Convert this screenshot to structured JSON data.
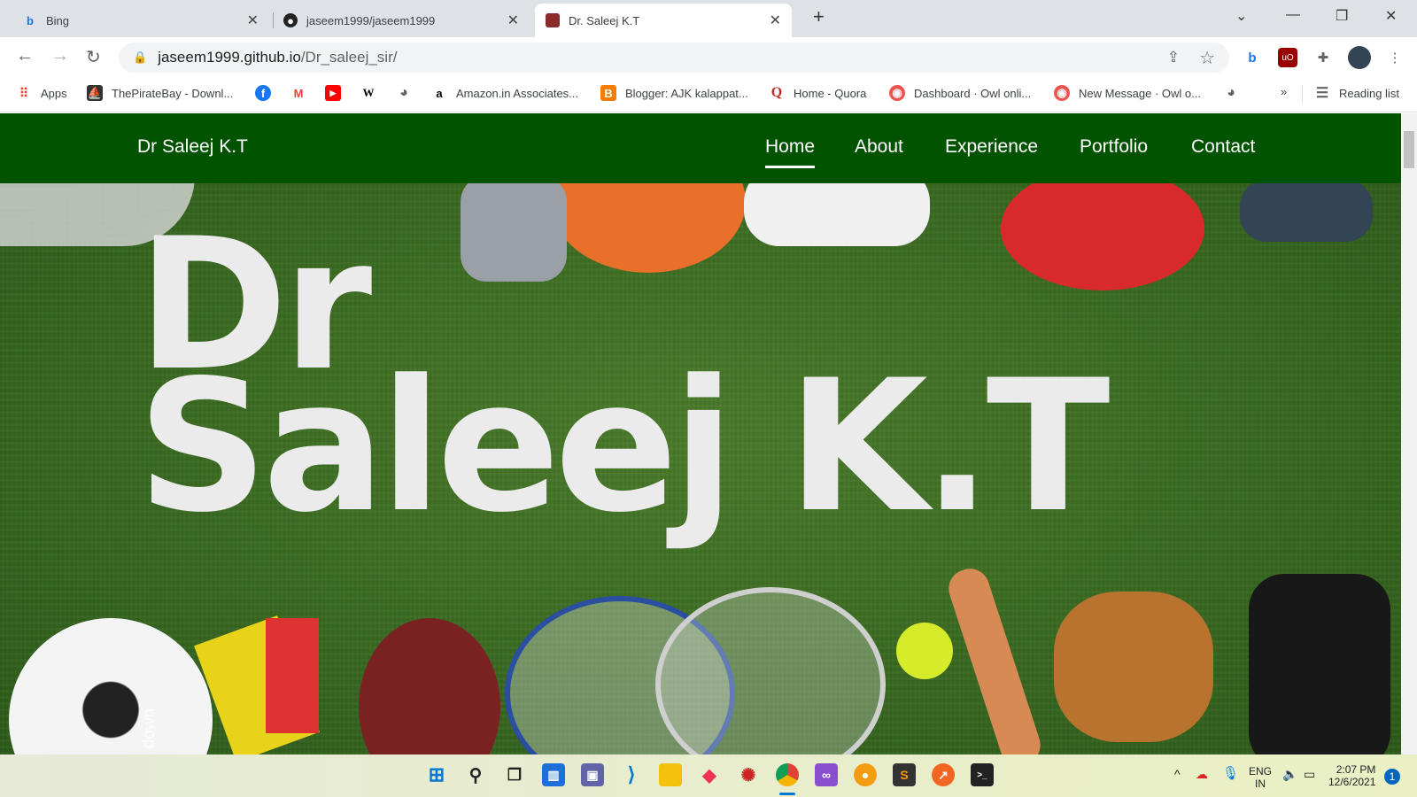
{
  "tabs": [
    {
      "title": "Bing",
      "icon": "bing-icon"
    },
    {
      "title": "jaseem1999/jaseem1999",
      "icon": "github-icon"
    },
    {
      "title": "Dr. Saleej K.T",
      "icon": "profile-icon",
      "active": true
    }
  ],
  "url": {
    "host": "jaseem1999.github.io",
    "path": "/Dr_saleej_sir/"
  },
  "bookmarks": [
    {
      "label": "Apps"
    },
    {
      "label": "ThePirateBay - Downl..."
    },
    {
      "label": "",
      "icon": "facebook-icon"
    },
    {
      "label": "",
      "icon": "gmail-icon"
    },
    {
      "label": "",
      "icon": "youtube-icon"
    },
    {
      "label": "",
      "icon": "wikipedia-icon"
    },
    {
      "label": "",
      "icon": "globe-icon"
    },
    {
      "label": "Amazon.in Associates..."
    },
    {
      "label": "Blogger: AJK kalappat..."
    },
    {
      "label": "Home - Quora"
    },
    {
      "label": "Dashboard · Owl onli..."
    },
    {
      "label": "New Message · Owl o..."
    },
    {
      "label": "",
      "icon": "globe-icon"
    }
  ],
  "reading_list": "Reading list",
  "overflow": "»",
  "site": {
    "brand": "Dr Saleej K.T",
    "nav": [
      "Home",
      "About",
      "Experience",
      "Portfolio",
      "Contact"
    ],
    "active_nav": "Home",
    "hero_line1": "Dr",
    "hero_line2": "Saleej K.T",
    "scroll": "↓ Scroll down"
  },
  "taskbar": {
    "lang1": "ENG",
    "lang2": "IN",
    "time": "2:07 PM",
    "date": "12/6/2021",
    "notifications": "1"
  },
  "colors": {
    "navbar": "#025300",
    "hero_text": "#ebebeb"
  }
}
